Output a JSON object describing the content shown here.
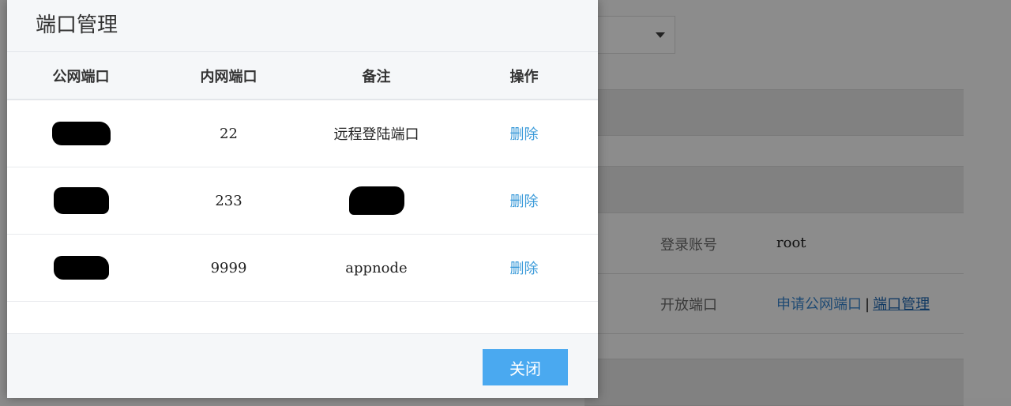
{
  "modal": {
    "title": "端口管理",
    "columns": [
      "公网端口",
      "内网端口",
      "备注",
      "操作"
    ],
    "rows": [
      {
        "public_port": "",
        "internal_port": "22",
        "note": "远程登陆端口",
        "action": "删除"
      },
      {
        "public_port": "",
        "internal_port": "233",
        "note": "",
        "action": "删除"
      },
      {
        "public_port": "",
        "internal_port": "9999",
        "note": "appnode",
        "action": "删除"
      }
    ],
    "close_label": "关闭"
  },
  "background": {
    "login_label": "登录账号",
    "login_value": "root",
    "ports_label": "开放端口",
    "apply_link": "申请公网端口",
    "separator": "|",
    "manage_link": "端口管理"
  },
  "colors": {
    "accent": "#4aa9f0",
    "link": "#3a9ad9",
    "header_bg": "#f5f7f9",
    "overlay": "#8c8c8c"
  }
}
